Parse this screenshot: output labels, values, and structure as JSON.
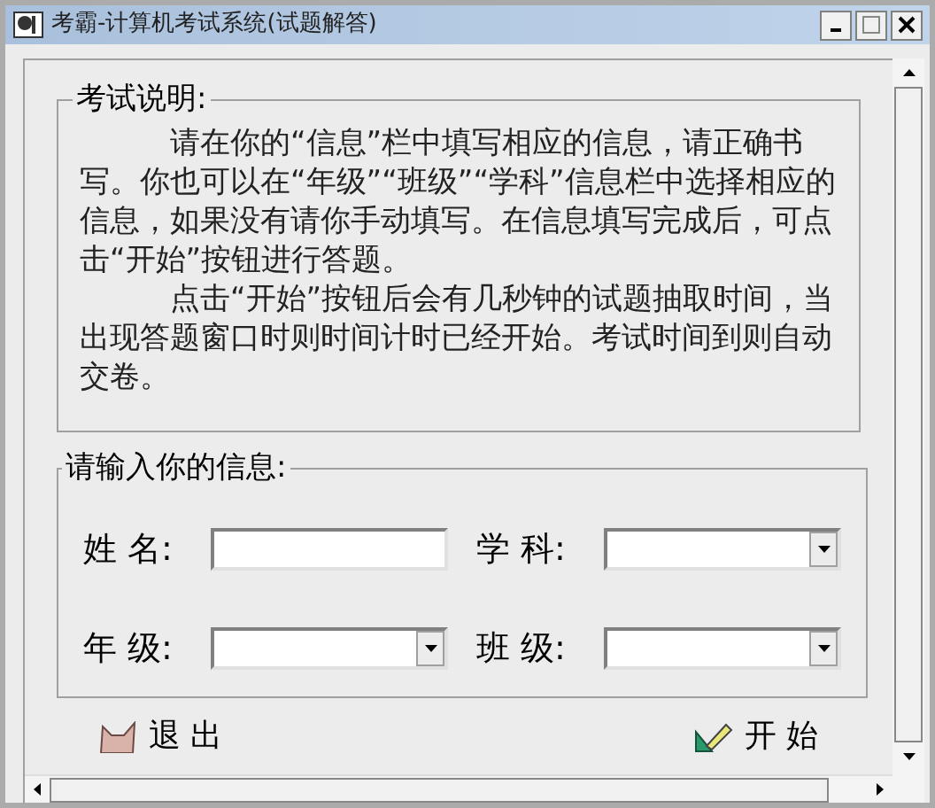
{
  "window": {
    "title": "考霸-计算机考试系统(试题解答)"
  },
  "instructions": {
    "title": "考试说明:",
    "paragraphs": [
      "请在你的“信息”栏中填写相应的信息，请正确书写。你也可以在“年级”“班级”“学科”信息栏中选择相应的信息，如果没有请你手动填写。在信息填写完成后，可点击“开始”按钮进行答题。",
      "点击“开始”按钮后会有几秒钟的试题抽取时间，当出现答题窗口时则时间计时已经开始。考试时间到则自动交卷。"
    ]
  },
  "info": {
    "title": "请输入你的信息:",
    "fields": [
      {
        "label": "姓 名:",
        "kind": "text"
      },
      {
        "label": "学 科:",
        "kind": "combo"
      },
      {
        "label": "年 级:",
        "kind": "combo"
      },
      {
        "label": "班 级:",
        "kind": "combo"
      }
    ]
  },
  "buttons": [
    {
      "label": "退 出",
      "kind": "exit"
    },
    {
      "label": "开 始",
      "kind": "start"
    }
  ]
}
